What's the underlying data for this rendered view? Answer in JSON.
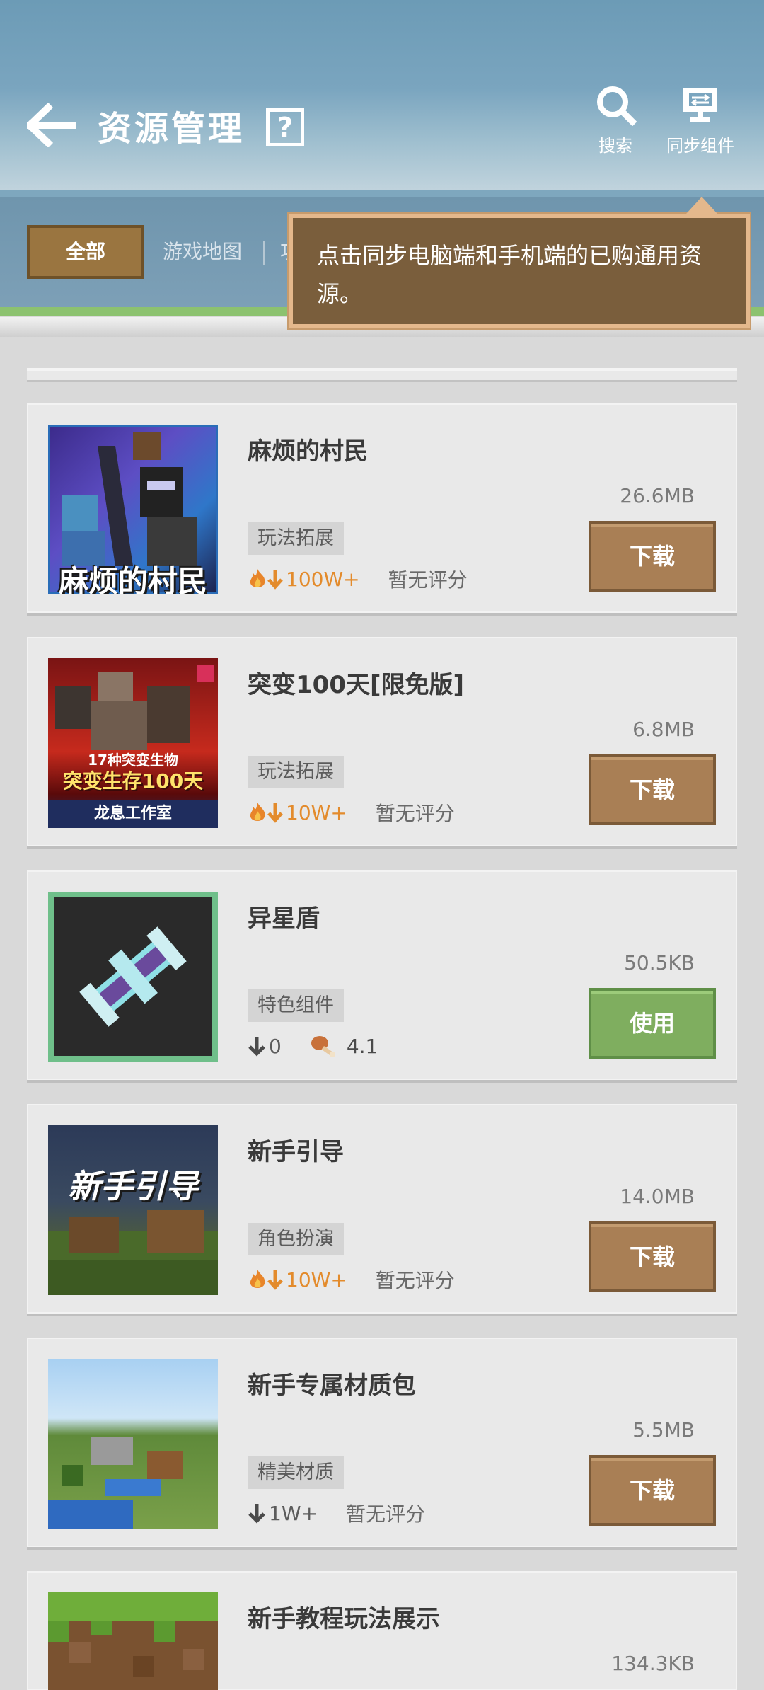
{
  "header": {
    "title": "资源管理",
    "help": "?",
    "search_label": "搜索",
    "sync_label": "同步组件"
  },
  "tabs": {
    "all": "全部",
    "map": "游戏地图",
    "func": "功能"
  },
  "tooltip": {
    "text": "点击同步电脑端和手机端的已购通用资源。"
  },
  "items": [
    {
      "title": "麻烦的村民",
      "size": "26.6MB",
      "tag": "玩法拓展",
      "downloads": "100W+",
      "rating": "暂无评分",
      "action": "下载",
      "hot": true,
      "thumb_text": "麻烦的村民"
    },
    {
      "title": "突变100天[限免版]",
      "size": "6.8MB",
      "tag": "玩法拓展",
      "downloads": "10W+",
      "rating": "暂无评分",
      "action": "下载",
      "hot": true,
      "thumb_text_1": "17种突变生物",
      "thumb_text_2": "突变生存100天",
      "thumb_text_3": "龙息工作室"
    },
    {
      "title": "异星盾",
      "size": "50.5KB",
      "tag": "特色组件",
      "downloads": "0",
      "rating": "4.1",
      "action": "使用",
      "hot": false
    },
    {
      "title": "新手引导",
      "size": "14.0MB",
      "tag": "角色扮演",
      "downloads": "10W+",
      "rating": "暂无评分",
      "action": "下载",
      "hot": true,
      "thumb_text": "新手引导"
    },
    {
      "title": "新手专属材质包",
      "size": "5.5MB",
      "tag": "精美材质",
      "downloads": "1W+",
      "rating": "暂无评分",
      "action": "下载",
      "hot": false
    },
    {
      "title": "新手教程玩法展示",
      "size": "134.3KB"
    }
  ],
  "colors": {
    "header_blue": "#6c9bb6",
    "tab_active": "#9a7540",
    "download_btn": "#a97f55",
    "use_btn": "#7fae5f",
    "hot_orange": "#e38b2c"
  }
}
